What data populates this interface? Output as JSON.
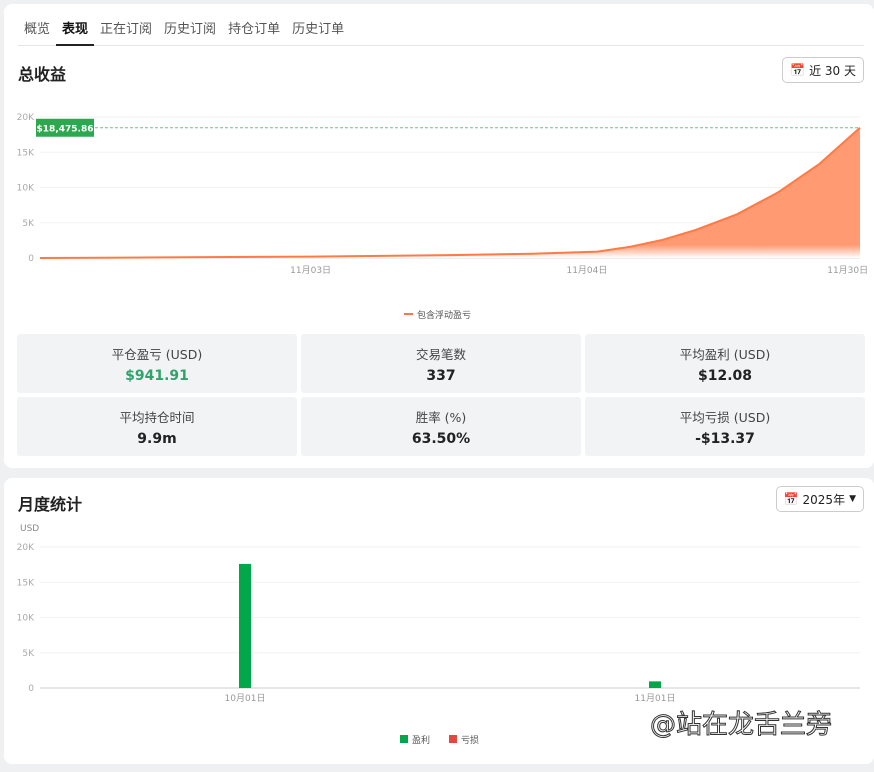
{
  "tabs": [
    "概览",
    "表现",
    "正在订阅",
    "历史订阅",
    "持仓订单",
    "历史订单"
  ],
  "active_tab": 1,
  "total": {
    "title": "总收益",
    "range_button": "近 30 天",
    "current_value_label": "$18,475.86"
  },
  "stats": [
    {
      "label": "平仓盈亏 (USD)",
      "value": "$941.91",
      "positive": true
    },
    {
      "label": "交易笔数",
      "value": "337"
    },
    {
      "label": "平均盈利 (USD)",
      "value": "$12.08"
    },
    {
      "label": "平均持仓时间",
      "value": "9.9m"
    },
    {
      "label": "胜率 (%)",
      "value": "63.50%"
    },
    {
      "label": "平均亏损 (USD)",
      "value": "-$13.37"
    }
  ],
  "monthly": {
    "title": "月度统计",
    "year_button": "2025年"
  },
  "colors": {
    "area": "#ff9a72",
    "line": "#ff7a45",
    "profit": "#00a84a",
    "loss": "#e8453c",
    "badge": "#2ea84f"
  },
  "watermark": "@站在龙舌兰旁",
  "chart_data": [
    {
      "type": "area",
      "title": "总收益",
      "ylim": [
        0,
        20000
      ],
      "yticks": [
        "0",
        "5K",
        "10K",
        "15K",
        "20K"
      ],
      "xticks": [
        {
          "label": "11月03日",
          "pos": 0.33
        },
        {
          "label": "11月04日",
          "pos": 0.667
        },
        {
          "label": "11月30日",
          "pos": 0.985
        }
      ],
      "legend": [
        "包含浮动盈亏"
      ],
      "points": [
        [
          0,
          0
        ],
        [
          0.15,
          80
        ],
        [
          0.33,
          200
        ],
        [
          0.5,
          400
        ],
        [
          0.6,
          600
        ],
        [
          0.68,
          900
        ],
        [
          0.72,
          1600
        ],
        [
          0.76,
          2600
        ],
        [
          0.8,
          4000
        ],
        [
          0.85,
          6200
        ],
        [
          0.9,
          9300
        ],
        [
          0.95,
          13300
        ],
        [
          1,
          18475.86
        ]
      ]
    },
    {
      "type": "bar",
      "title": "月度统计",
      "ylabel": "USD",
      "ylim": [
        0,
        20000
      ],
      "yticks": [
        "0",
        "5K",
        "10K",
        "15K",
        "20K"
      ],
      "categories": [
        "10月01日",
        "11月01日"
      ],
      "series": [
        {
          "name": "盈利",
          "values": [
            17600,
            941.91
          ]
        },
        {
          "name": "亏损",
          "values": [
            0,
            0
          ]
        }
      ]
    }
  ]
}
